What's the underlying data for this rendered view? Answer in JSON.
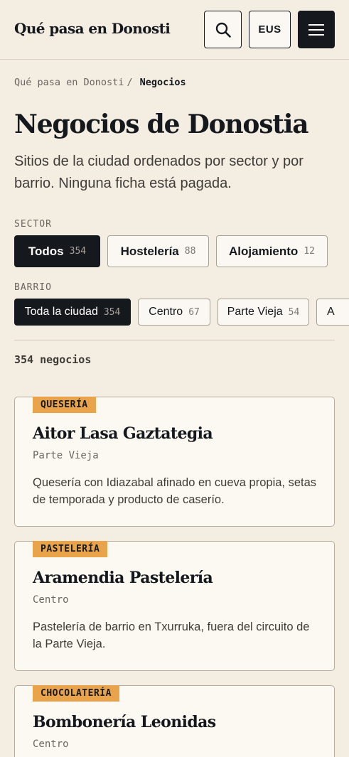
{
  "header": {
    "brand": "Qué pasa en Donosti",
    "search_icon": "search-icon",
    "lang_label": "EUS",
    "menu_icon": "hamburger-menu-icon"
  },
  "breadcrumb": {
    "parent": "Qué pasa en Donosti",
    "separator": "/",
    "current": "Negocios"
  },
  "page": {
    "title": "Negocios de Donostia",
    "lead": "Sitios de la ciudad ordenados por sector y por barrio. Ninguna ficha está pagada."
  },
  "filters": {
    "sector_label": "SECTOR",
    "sector": [
      {
        "label": "Todos",
        "count": "354",
        "active": true
      },
      {
        "label": "Hostelería",
        "count": "88",
        "active": false
      },
      {
        "label": "Alojamiento",
        "count": "12",
        "active": false
      }
    ],
    "barrio_label": "BARRIO",
    "barrio": [
      {
        "label": "Toda la ciudad",
        "count": "354",
        "active": true
      },
      {
        "label": "Centro",
        "count": "67",
        "active": false
      },
      {
        "label": "Parte Vieja",
        "count": "54",
        "active": false
      },
      {
        "label": "A",
        "count": "",
        "active": false
      }
    ]
  },
  "results": {
    "count_label": "354 negocios"
  },
  "listings": [
    {
      "tag": "QUESERÍA",
      "name": "Aitor Lasa Gaztategia",
      "neighborhood": "Parte Vieja",
      "description": "Quesería con Idiazabal afinado en cueva propia, setas de temporada y producto de caserío."
    },
    {
      "tag": "PASTELERÍA",
      "name": "Aramendia Pastelería",
      "neighborhood": "Centro",
      "description": "Pastelería de barrio en Txurruka, fuera del circuito de la Parte Vieja."
    },
    {
      "tag": "CHOCOLATERÍA",
      "name": "Bombonería Leonidas",
      "neighborhood": "Centro",
      "description": ""
    }
  ],
  "colors": {
    "background": "#f4ede2",
    "ink": "#15181d",
    "tag": "#e9a44b"
  }
}
